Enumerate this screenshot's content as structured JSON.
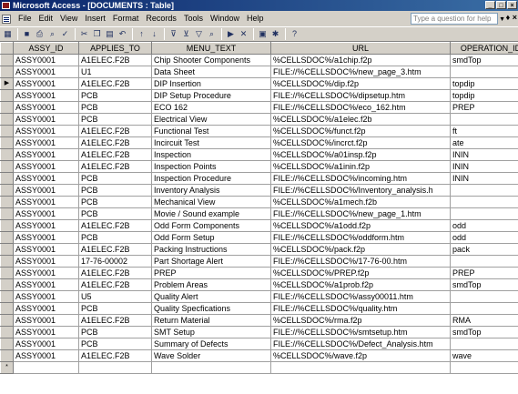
{
  "window": {
    "title": "Microsoft Access - [DOCUMENTS : Table]"
  },
  "window_buttons": [
    "_",
    "□",
    "×"
  ],
  "menu": [
    "File",
    "Edit",
    "View",
    "Insert",
    "Format",
    "Records",
    "Tools",
    "Window",
    "Help"
  ],
  "help_placeholder": "Type a question for help",
  "mdi_buttons": "- ♦ ×",
  "toolbar_icons": [
    "view-icon",
    "save-icon",
    "print-icon",
    "print-preview-icon",
    "spelling-icon",
    "cut-icon",
    "copy-icon",
    "paste-icon",
    "undo-icon",
    "sort-ascending-icon",
    "sort-descending-icon",
    "filter-by-selection-icon",
    "filter-by-form-icon",
    "apply-filter-icon",
    "find-icon",
    "new-record-icon",
    "delete-record-icon",
    "database-window-icon",
    "new-object-icon",
    "help-icon"
  ],
  "columns": [
    "ASSY_ID",
    "APPLIES_TO",
    "MENU_TEXT",
    "URL",
    "OPERATION_ID"
  ],
  "rows": [
    [
      "ASSY0001",
      "A1ELEC.F2B",
      "Chip Shooter Components",
      "%CELLSDOC%/a1chip.f2p",
      "smdTop"
    ],
    [
      "ASSY0001",
      "U1",
      "Data Sheet",
      "FILE://%CELLSDOC%/new_page_3.htm",
      ""
    ],
    [
      "ASSY0001",
      "A1ELEC.F2B",
      "DIP Insertion",
      "%CELLSDOC%/dip.f2p",
      "topdip"
    ],
    [
      "ASSY0001",
      "PCB",
      "DIP Setup Procedure",
      "FILE://%CELLSDOC%/dipsetup.htm",
      "topdip"
    ],
    [
      "ASSY0001",
      "PCB",
      "ECO 162",
      "FILE://%CELLSDOC%/eco_162.htm",
      "PREP"
    ],
    [
      "ASSY0001",
      "PCB",
      "Electrical View",
      "%CELLSDOC%/a1elec.f2b",
      ""
    ],
    [
      "ASSY0001",
      "A1ELEC.F2B",
      "Functional Test",
      "%CELLSDOC%/funct.f2p",
      "ft"
    ],
    [
      "ASSY0001",
      "A1ELEC.F2B",
      "Incircuit Test",
      "%CELLSDOC%/incrct.f2p",
      "ate"
    ],
    [
      "ASSY0001",
      "A1ELEC.F2B",
      "Inspection",
      "%CELLSDOC%/a01insp.f2p",
      "ININ"
    ],
    [
      "ASSY0001",
      "A1ELEC.F2B",
      "Inspection Points",
      "%CELLSDOC%/a1inin.f2p",
      "ININ"
    ],
    [
      "ASSY0001",
      "PCB",
      "Inspection Procedure",
      "FILE://%CELLSDOC%/incoming.htm",
      "ININ"
    ],
    [
      "ASSY0001",
      "PCB",
      "Inventory Analysis",
      "FILE://%CELLSDOC%/Inventory_analysis.h",
      ""
    ],
    [
      "ASSY0001",
      "PCB",
      "Mechanical View",
      "%CELLSDOC%/a1mech.f2b",
      ""
    ],
    [
      "ASSY0001",
      "PCB",
      "Movie / Sound example",
      "FILE://%CELLSDOC%/new_page_1.htm",
      ""
    ],
    [
      "ASSY0001",
      "A1ELEC.F2B",
      "Odd Form Components",
      "%CELLSDOC%/a1odd.f2p",
      "odd"
    ],
    [
      "ASSY0001",
      "PCB",
      "Odd Form Setup",
      "FILE://%CELLSDOC%/oddform.htm",
      "odd"
    ],
    [
      "ASSY0001",
      "A1ELEC.F2B",
      "Packing Instructions",
      "%CELLSDOC%/pack.f2p",
      "pack"
    ],
    [
      "ASSY0001",
      "17-76-00002",
      "Part Shortage Alert",
      "FILE://%CELLSDOC%/17-76-00.htm",
      ""
    ],
    [
      "ASSY0001",
      "A1ELEC.F2B",
      "PREP",
      "%CELLSDOC%/PREP.f2p",
      "PREP"
    ],
    [
      "ASSY0001",
      "A1ELEC.F2B",
      "Problem Areas",
      "%CELLSDOC%/a1prob.f2p",
      "smdTop"
    ],
    [
      "ASSY0001",
      "U5",
      "Quality Alert",
      "FILE://%CELLSDOC%/assy00011.htm",
      ""
    ],
    [
      "ASSY0001",
      "PCB",
      "Quality Specfications",
      "FILE://%CELLSDOC%/quality.htm",
      ""
    ],
    [
      "ASSY0001",
      "A1ELEC.F2B",
      "Return Material",
      "%CELLSDOC%/rma.f2p",
      "RMA"
    ],
    [
      "ASSY0001",
      "PCB",
      "SMT Setup",
      "FILE://%CELLSDOC%/smtsetup.htm",
      "smdTop"
    ],
    [
      "ASSY0001",
      "PCB",
      "Summary of Defects",
      "FILE://%CELLSDOC%/Defect_Analysis.htm",
      ""
    ],
    [
      "ASSY0001",
      "A1ELEC.F2B",
      "Wave Solder",
      "%CELLSDOC%/wave.f2p",
      "wave"
    ]
  ],
  "current_row_index": 2,
  "current_row_marker": "▶",
  "new_row_marker": "*"
}
